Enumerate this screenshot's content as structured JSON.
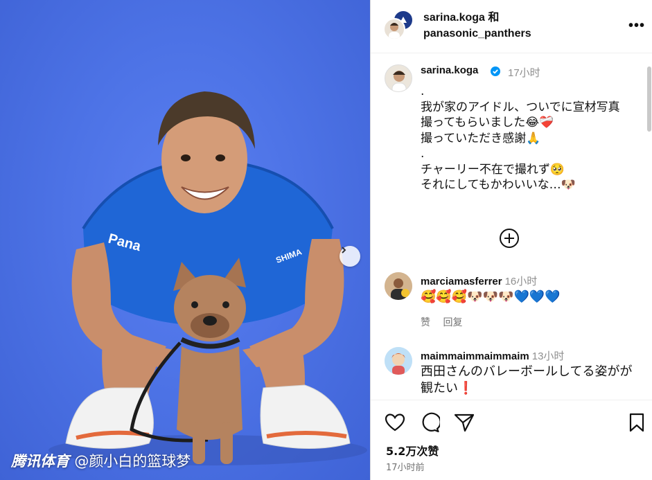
{
  "photo": {
    "watermark_brand": "腾讯体育",
    "watermark_author": "@颜小白的篮球梦"
  },
  "header": {
    "user1": "sarina.koga 和",
    "user2": "panasonic_panthers"
  },
  "caption": {
    "username": "sarina.koga",
    "time": "17小时",
    "text": ".\n我が家のアイドル、ついでに宣材写真\n撮ってもらいました😂❤️‍🩹\n撮っていただき感謝🙏\n.\nチャーリー不在で撮れず🥺\nそれにしてもかわいいな…🐶"
  },
  "comments": [
    {
      "username": "marciamasferrer",
      "time": "16小时",
      "text": "🥰🥰🥰🐶🐶🐶💙💙💙",
      "like_label": "赞",
      "reply_label": "回复"
    },
    {
      "username": "maimmaimmaimmaim",
      "time": "13小时",
      "text": "西田さんのバレーボールしてる姿がが観たい❗"
    }
  ],
  "footer": {
    "likes": "5.2万次赞",
    "posted": "17小时前"
  },
  "colors": {
    "background_blue": "#4d73e6",
    "verified_blue": "#0095f6",
    "muted_text": "#8e8e8e"
  }
}
